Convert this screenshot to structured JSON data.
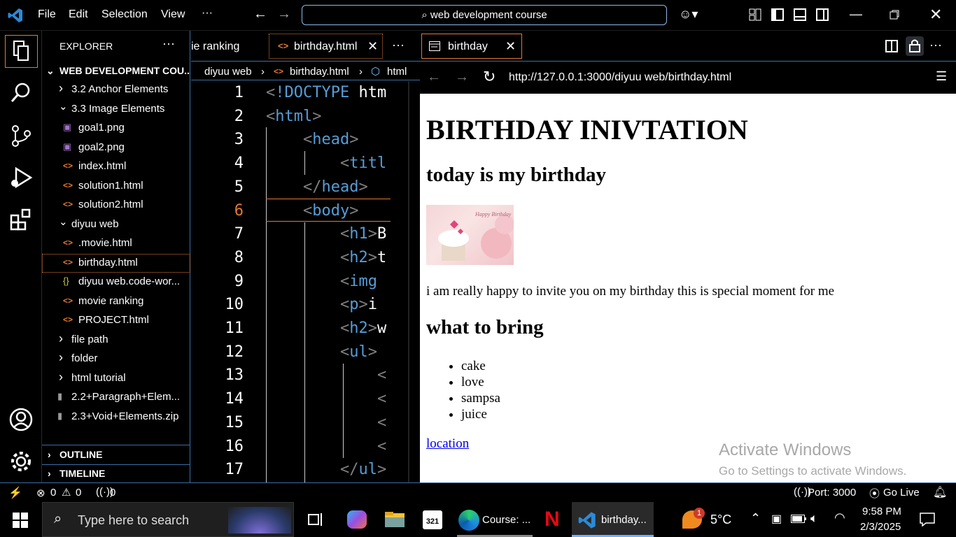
{
  "titlebar": {
    "menus": [
      "File",
      "Edit",
      "Selection",
      "View",
      "···"
    ],
    "search": "web development course"
  },
  "sidebar": {
    "header": "EXPLORER",
    "folder": "WEB DEVELOPMENT COU...",
    "items": [
      {
        "label": "3.2 Anchor Elements",
        "kind": "folder-closed",
        "indent": 1
      },
      {
        "label": "3.3 Image Elements",
        "kind": "folder-open",
        "indent": 1
      },
      {
        "label": "goal1.png",
        "kind": "image",
        "indent": 2
      },
      {
        "label": "goal2.png",
        "kind": "image",
        "indent": 2
      },
      {
        "label": "index.html",
        "kind": "html",
        "indent": 2
      },
      {
        "label": "solution1.html",
        "kind": "html",
        "indent": 2
      },
      {
        "label": "solution2.html",
        "kind": "html",
        "indent": 2
      },
      {
        "label": "diyuu web",
        "kind": "folder-open",
        "indent": 1
      },
      {
        "label": ".movie.html",
        "kind": "html",
        "indent": 2
      },
      {
        "label": "birthday.html",
        "kind": "html",
        "indent": 2,
        "selected": true
      },
      {
        "label": "diyuu web.code-wor...",
        "kind": "json",
        "indent": 2
      },
      {
        "label": "movie ranking",
        "kind": "html",
        "indent": 2
      },
      {
        "label": "PROJECT.html",
        "kind": "html",
        "indent": 2
      },
      {
        "label": "file path",
        "kind": "folder-closed",
        "indent": 1
      },
      {
        "label": "folder",
        "kind": "folder-closed",
        "indent": 1
      },
      {
        "label": "html tutorial",
        "kind": "folder-closed",
        "indent": 1
      },
      {
        "label": "2.2+Paragraph+Elem...",
        "kind": "zip",
        "indent": 1
      },
      {
        "label": "2.3+Void+Elements.zip",
        "kind": "zip",
        "indent": 1
      }
    ],
    "outline": "OUTLINE",
    "timeline": "TIMELINE"
  },
  "editor": {
    "tab_prev": "ie ranking",
    "tab_active": "birthday.html",
    "more": "···",
    "breadcrumb": [
      "diyuu web",
      "birthday.html",
      "html"
    ],
    "lines": [
      {
        "n": "1",
        "text": "<!DOCTYPE htm"
      },
      {
        "n": "2",
        "text": "<html>"
      },
      {
        "n": "3",
        "text": "    <head>"
      },
      {
        "n": "4",
        "text": "        <titl"
      },
      {
        "n": "5",
        "text": "    </head>"
      },
      {
        "n": "6",
        "text": "    <body>"
      },
      {
        "n": "7",
        "text": "        <h1>B"
      },
      {
        "n": "8",
        "text": "        <h2>t"
      },
      {
        "n": "9",
        "text": "        <img"
      },
      {
        "n": "10",
        "text": "        <p>i"
      },
      {
        "n": "11",
        "text": "        <h2>w"
      },
      {
        "n": "12",
        "text": "        <ul>"
      },
      {
        "n": "13",
        "text": "            <"
      },
      {
        "n": "14",
        "text": "            <"
      },
      {
        "n": "15",
        "text": "            <"
      },
      {
        "n": "16",
        "text": "            <"
      },
      {
        "n": "17",
        "text": "        </ul>"
      }
    ]
  },
  "preview": {
    "tab": "birthday",
    "url": "http://127.0.0.1:3000/diyuu web/birthday.html",
    "h1": "BIRTHDAY INIVTATION",
    "h2a": "today is my birthday",
    "p": "i am really happy to invite you on my birthday this is special moment for me",
    "h2b": "what to bring",
    "list": [
      "cake",
      "love",
      "sampsa",
      "juice"
    ],
    "link": "location",
    "watermark1": "Activate Windows",
    "watermark2": "Go to Settings to activate Windows.",
    "image_caption": "Happy Birthday"
  },
  "status": {
    "errors": "0",
    "warnings": "0",
    "ports": "0",
    "port": "Port: 3000",
    "golive": "Go Live"
  },
  "taskbar": {
    "search": "Type here to search",
    "app1": "Course: ...",
    "app2": "birthday...",
    "weather": "5°C",
    "badge": "1",
    "time": "9:58 PM",
    "date": "2/3/2025"
  }
}
